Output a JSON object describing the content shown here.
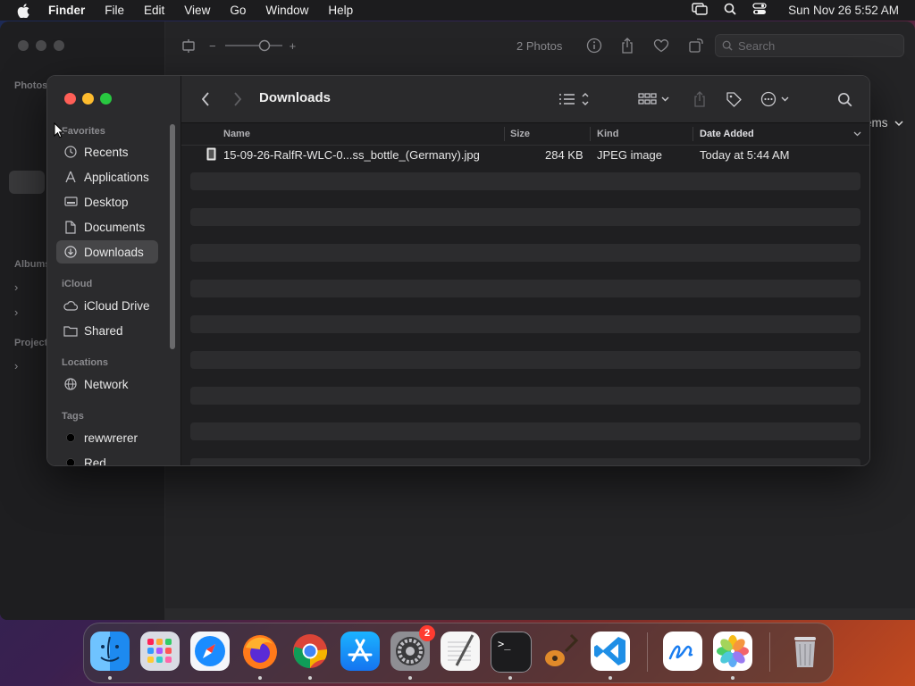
{
  "menubar": {
    "app_name": "Finder",
    "menus": [
      "File",
      "Edit",
      "View",
      "Go",
      "Window",
      "Help"
    ],
    "clock": "Sun Nov 26  5:52 AM"
  },
  "photos_window": {
    "photo_count": "2 Photos",
    "search_placeholder": "Search",
    "sidebar_labels": {
      "photos": "Photos",
      "albums": "Albums",
      "projects": "Projects"
    },
    "items_label": "ems"
  },
  "finder": {
    "title": "Downloads",
    "sidebar": {
      "favorites_label": "Favorites",
      "favorites": [
        {
          "label": "Recents",
          "icon": "clock-icon"
        },
        {
          "label": "Applications",
          "icon": "applications-icon"
        },
        {
          "label": "Desktop",
          "icon": "desktop-icon"
        },
        {
          "label": "Documents",
          "icon": "document-icon"
        },
        {
          "label": "Downloads",
          "icon": "download-icon"
        }
      ],
      "icloud_label": "iCloud",
      "icloud": [
        {
          "label": "iCloud Drive",
          "icon": "cloud-icon"
        },
        {
          "label": "Shared",
          "icon": "shared-folder-icon"
        }
      ],
      "locations_label": "Locations",
      "locations": [
        {
          "label": "Network",
          "icon": "globe-icon"
        }
      ],
      "tags_label": "Tags",
      "tags": [
        {
          "label": "rewwrerer",
          "color": "#000000"
        },
        {
          "label": "Red",
          "color": "#000000"
        }
      ]
    },
    "columns": {
      "name": "Name",
      "size": "Size",
      "kind": "Kind",
      "date_added": "Date Added"
    },
    "files": [
      {
        "name": "15-09-26-RalfR-WLC-0...ss_bottle_(Germany).jpg",
        "size": "284 KB",
        "kind": "JPEG image",
        "date_added": "Today at 5:44 AM"
      }
    ]
  },
  "dock": {
    "apps": [
      "Finder",
      "Launchpad",
      "Safari",
      "Firefox",
      "Chrome",
      "App Store",
      "System Settings",
      "TextEdit",
      "Terminal",
      "GarageBand",
      "Visual Studio Code",
      "Freeform",
      "Photos",
      "Trash"
    ],
    "settings_badge": "2",
    "terminal_prompt": ">_"
  },
  "colors": {
    "selection": "#464648",
    "close": "#ff5f57",
    "minimize": "#febc2e",
    "zoom": "#28c840"
  }
}
